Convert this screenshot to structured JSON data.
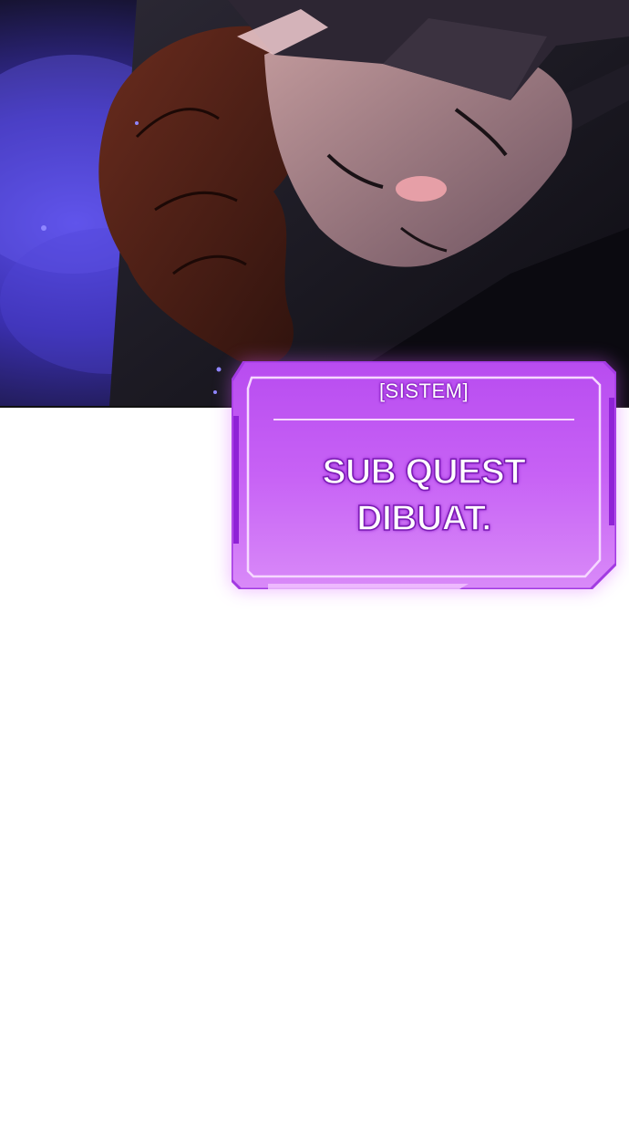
{
  "illustration": {
    "subject": "Unconscious brown-haired man lying on stone floor with blue-purple aura",
    "colors": {
      "aura": "#4a3ad6",
      "hair": "#4e1f16",
      "skin": "#b58e8e",
      "shadow": "#17131f",
      "blush": "#f0a4ac"
    }
  },
  "system_window": {
    "header": "[SISTEM]",
    "message_line1": "SUB QUEST",
    "message_line2": "DIBUAT.",
    "colors": {
      "fill": "#c15af2",
      "border": "#9e2ce0",
      "glow": "#d65cff",
      "text": "#ffffff"
    }
  }
}
